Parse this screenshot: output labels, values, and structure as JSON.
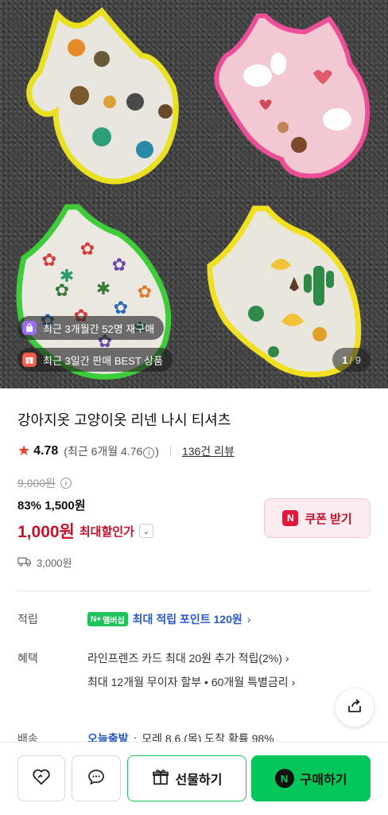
{
  "gallery": {
    "badges": [
      {
        "icon": "shopping-bag-icon",
        "text": "최근 3개월간 52명 재구매"
      },
      {
        "icon": "gift-box-icon",
        "text": "최근 3일간 판매 BEST 상품"
      }
    ],
    "pager": {
      "current": "1",
      "total": "/ 9"
    }
  },
  "product": {
    "title": "강아지옷 고양이옷 리넨 나시 티셔츠",
    "rating": "4.78",
    "rating_recent_prefix": "(최근 6개월 4.76",
    "rating_recent_suffix": ")",
    "review_count": "136건 리뷰",
    "original_price": "9,000원",
    "sale_price": "83% 1,500원",
    "max_discount_price": "1,000원",
    "max_discount_label": "최대할인가",
    "coupon_label": "쿠폰 받기",
    "shipping_fee": "3,000원"
  },
  "details": {
    "points_label": "적립",
    "points_badge": "N+",
    "points_membership": "멤버십",
    "points_text": "최대 적립 포인트 120원",
    "benefit_label": "혜택",
    "benefit_lines": [
      "라인프렌즈 카드 최대 20원 추가 적립(2%)",
      "최대 12개월 무이자 할부 • 60개월 특별금리"
    ],
    "delivery_label": "배송",
    "delivery_today": "오늘출발",
    "delivery_dot": "·",
    "delivery_text": "모레 8.6.(목) 도착 확률 98%"
  },
  "bottom_bar": {
    "gift_label": "선물하기",
    "buy_label": "구매하기",
    "buy_badge": "N"
  },
  "colors": {
    "accent_red": "#c8102e",
    "naver_green": "#03c75a",
    "link_blue": "#2a58c9"
  }
}
